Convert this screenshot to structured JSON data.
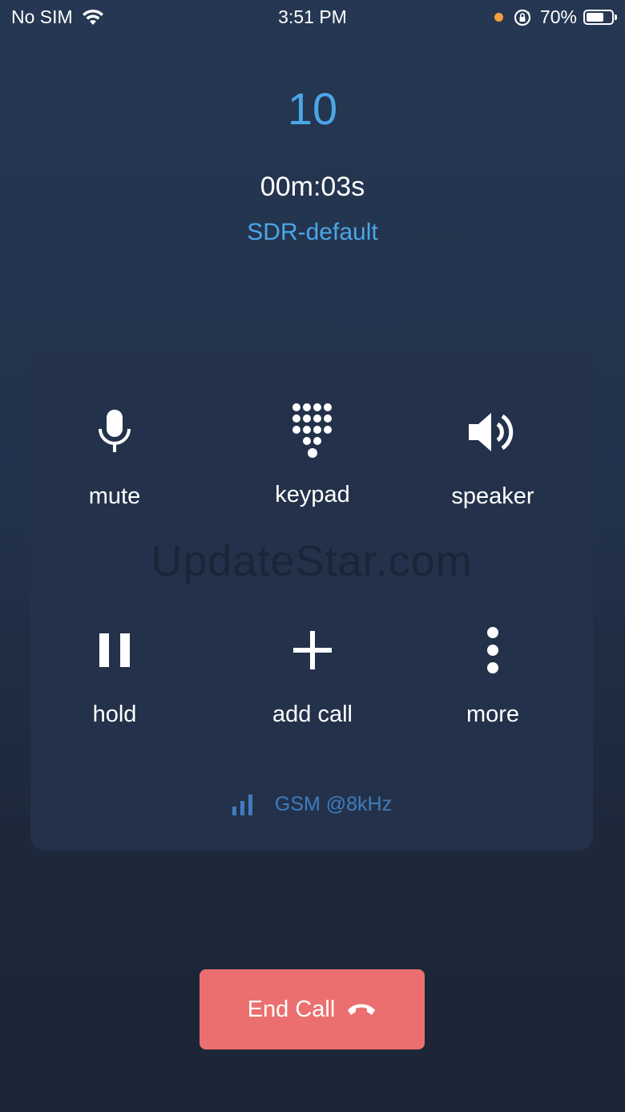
{
  "status_bar": {
    "carrier": "No SIM",
    "time": "3:51 PM",
    "battery_percent": "70%",
    "battery_level": 0.7,
    "indicator_color": "#f2a03d"
  },
  "call": {
    "number": "10",
    "duration": "00m:03s",
    "account": "SDR-default"
  },
  "controls": [
    {
      "label": "mute",
      "icon": "microphone-icon"
    },
    {
      "label": "keypad",
      "icon": "keypad-icon"
    },
    {
      "label": "speaker",
      "icon": "speaker-icon"
    },
    {
      "label": "hold",
      "icon": "pause-icon"
    },
    {
      "label": "add call",
      "icon": "plus-icon"
    },
    {
      "label": "more",
      "icon": "more-vertical-icon"
    }
  ],
  "watermark": "UpdateStar.com",
  "codec": {
    "label": "GSM @8kHz",
    "icon": "signal-bars-icon"
  },
  "end_call": {
    "label": "End Call",
    "icon": "hangup-icon",
    "color": "#ec6f6f"
  },
  "colors": {
    "accent": "#4ca6e8",
    "panel": "#23324a",
    "codec_text": "#3f7cbf"
  }
}
